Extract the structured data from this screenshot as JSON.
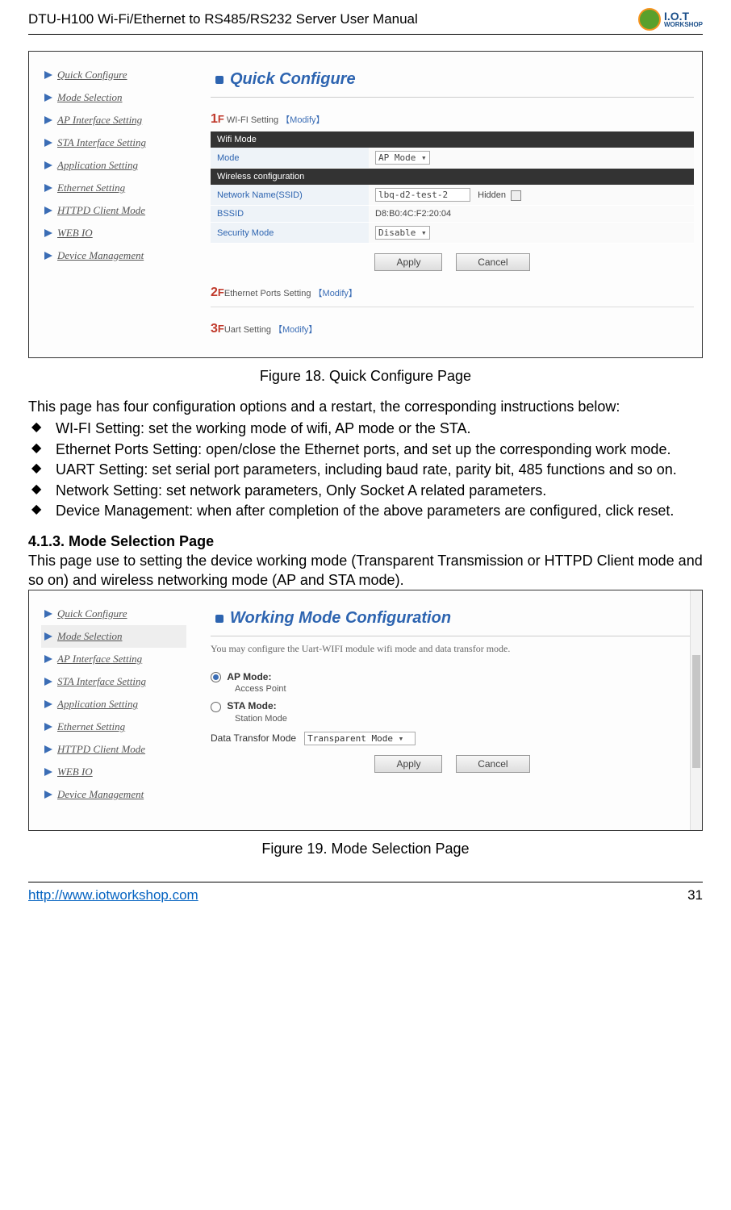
{
  "header": {
    "doc_title": "DTU-H100  Wi-Fi/Ethernet to RS485/RS232  Server User Manual",
    "logo_main": "I.O.T",
    "logo_sub": "WORKSHOP"
  },
  "nav": {
    "items": [
      "Quick Configure",
      "Mode Selection",
      "AP Interface Setting",
      "STA Interface Setting",
      "Application Setting",
      "Ethernet Setting",
      "HTTPD Client Mode",
      "WEB IO",
      "Device Management"
    ]
  },
  "fig18": {
    "title": "Quick Configure",
    "s1_num": "1",
    "s1_letter": "F",
    "s1_label": " WI-FI Setting ",
    "modify": "【Modify】",
    "wifi_mode_hdr": "Wifi Mode",
    "mode_lbl": "Mode",
    "mode_val": "AP Mode",
    "wireless_hdr": "Wireless configuration",
    "ssid_lbl": "Network Name(SSID)",
    "ssid_val": "lbq-d2-test-2",
    "hidden_lbl": "Hidden",
    "bssid_lbl": "BSSID",
    "bssid_val": "D8:B0:4C:F2:20:04",
    "sec_lbl": "Security Mode",
    "sec_val": "Disable",
    "apply": "Apply",
    "cancel": "Cancel",
    "s2_num": "2",
    "s2_letter": "F",
    "s2_label": "Ethernet Ports Setting ",
    "s3_num": "3",
    "s3_letter": "F",
    "s3_label": "Uart Setting ",
    "caption": "Figure 18.   Quick Configure Page"
  },
  "body1": {
    "intro": "This page has four configuration options and a restart, the corresponding instructions below:",
    "bullets": [
      "WI-FI Setting: set the working mode of wifi, AP mode or the STA.",
      "Ethernet Ports Setting: open/close the Ethernet ports, and set up the corresponding work mode.",
      "UART Setting: set serial port parameters, including baud rate, parity bit, 485 functions and so on.",
      "Network Setting: set network parameters, Only Socket A related parameters.",
      "Device Management: when after completion of the above parameters are configured, click reset."
    ]
  },
  "sec413": {
    "heading": "4.1.3.    Mode Selection Page",
    "text": "This page use to setting the device working mode (Transparent Transmission or HTTPD Client mode and so on) and wireless networking mode (AP and STA mode)."
  },
  "fig19": {
    "title": "Working Mode Configuration",
    "desc": "You may configure the Uart-WIFI module wifi mode and data transfor mode.",
    "ap_label": "AP Mode:",
    "ap_sub": "Access Point",
    "sta_label": "STA Mode:",
    "sta_sub": "Station Mode",
    "dt_label": "Data Transfor Mode",
    "dt_val": "Transparent Mode",
    "apply": "Apply",
    "cancel": "Cancel",
    "caption": "Figure 19.   Mode Selection Page"
  },
  "footer": {
    "url": "http://www.iotworkshop.com",
    "page": "31"
  }
}
